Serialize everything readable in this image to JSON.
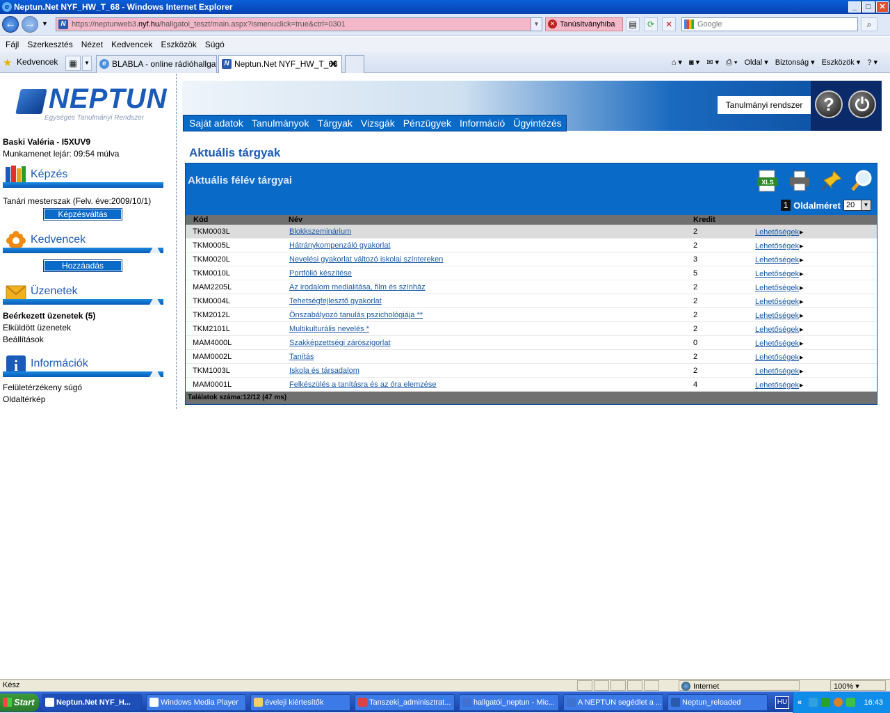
{
  "window": {
    "title": "Neptun.Net NYF_HW_T_68 - Windows Internet Explorer"
  },
  "address": {
    "url_prefix": "https://neptunweb3.",
    "url_domain": "nyf.hu",
    "url_suffix": "/hallgatoi_teszt/main.aspx?ismenuclick=true&ctrl=0301",
    "cert_error": "Tanúsítványhiba",
    "search_placeholder": "Google"
  },
  "menubar": [
    "Fájl",
    "Szerkesztés",
    "Nézet",
    "Kedvencek",
    "Eszközök",
    "Súgó"
  ],
  "favbar": {
    "favorites": "Kedvencek",
    "tabs": [
      {
        "label": "BLABLA - online rádióhallgat..."
      },
      {
        "label": "Neptun.Net NYF_HW_T_68"
      }
    ],
    "commands": [
      "Oldal ▾",
      "Biztonság ▾",
      "Eszközök ▾"
    ]
  },
  "sidebar": {
    "logo_word": "NEPTUN",
    "logo_sub": "Egységes Tanulmányi Rendszer",
    "user": "Baski Valéria - I5XUV9",
    "session": "Munkamenet lejár: 09:54 múlva",
    "kepzes": {
      "title": "Képzés",
      "text": "Tanári mesterszak (Felv. éve:2009/10/1)",
      "button": "Képzésváltás"
    },
    "kedvencek": {
      "title": "Kedvencek",
      "button": "Hozzáadás"
    },
    "uzenetek": {
      "title": "Üzenetek",
      "items": [
        "Beérkezett üzenetek (5)",
        "Elküldött üzenetek",
        "Beállítások"
      ]
    },
    "informaciok": {
      "title": "Információk",
      "items": [
        "Felületérzékeny súgó",
        "Oldaltérkép"
      ]
    }
  },
  "banner": {
    "system": "Tanulmányi rendszer"
  },
  "mainmenu": [
    "Saját adatok",
    "Tanulmányok",
    "Tárgyak",
    "Vizsgák",
    "Pénzügyek",
    "Információ",
    "Ügyintézés"
  ],
  "page": {
    "title": "Aktuális tárgyak"
  },
  "panel": {
    "title": "Aktuális félév tárgyai",
    "page_number": "1",
    "page_size_label": "Oldalméret",
    "page_size_value": "20",
    "columns": {
      "kod": "Kód",
      "nev": "Név",
      "kredit": "Kredit"
    },
    "rows": [
      {
        "kod": "TKM0003L",
        "nev": "Blokkszeminárium",
        "kredit": "2",
        "action": "Lehetőségek"
      },
      {
        "kod": "TKM0005L",
        "nev": "Hátránykompenzáló gyakorlat",
        "kredit": "2",
        "action": "Lehetőségek"
      },
      {
        "kod": "TKM0020L",
        "nev": "Nevelési gyakorlat változó iskolai színtereken",
        "kredit": "3",
        "action": "Lehetőségek"
      },
      {
        "kod": "TKM0010L",
        "nev": "Portfólió készítése",
        "kredit": "5",
        "action": "Lehetőségek"
      },
      {
        "kod": "MAM2205L",
        "nev": "Az irodalom medialitása, film és színház",
        "kredit": "2",
        "action": "Lehetőségek"
      },
      {
        "kod": "TKM0004L",
        "nev": "Tehetségfejlesztő gyakorlat",
        "kredit": "2",
        "action": "Lehetőségek"
      },
      {
        "kod": "TKM2012L",
        "nev": "Önszabályozó tanulás pszichológiája **",
        "kredit": "2",
        "action": "Lehetőségek"
      },
      {
        "kod": "TKM2101L",
        "nev": "Multikulturális nevelés *",
        "kredit": "2",
        "action": "Lehetőségek"
      },
      {
        "kod": "MAM4000L",
        "nev": "Szakképzettségi zárószigorlat",
        "kredit": "0",
        "action": "Lehetőségek"
      },
      {
        "kod": "MAM0002L",
        "nev": "Tanítás",
        "kredit": "2",
        "action": "Lehetőségek"
      },
      {
        "kod": "TKM1003L",
        "nev": "Iskola és társadalom",
        "kredit": "2",
        "action": "Lehetőségek"
      },
      {
        "kod": "MAM0001L",
        "nev": "Felkészülés a tanításra és az óra elemzése",
        "kredit": "4",
        "action": "Lehetőségek"
      }
    ],
    "footer": "Találatok száma:12/12 (47 ms)"
  },
  "statusbar": {
    "left": "Kész",
    "zone": "Internet",
    "zoom": "100% ▾"
  },
  "taskbar": {
    "start": "Start",
    "items": [
      "Neptun.Net NYF_H...",
      "Windows Media Player",
      "éveleji kiértesítők",
      "Tanszeki_adminisztrat...",
      "hallgatói_neptun - Mic...",
      "A NEPTUN segédlet a ...",
      "Neptun_reloaded"
    ],
    "lang": "HU",
    "clock": "16:43"
  }
}
